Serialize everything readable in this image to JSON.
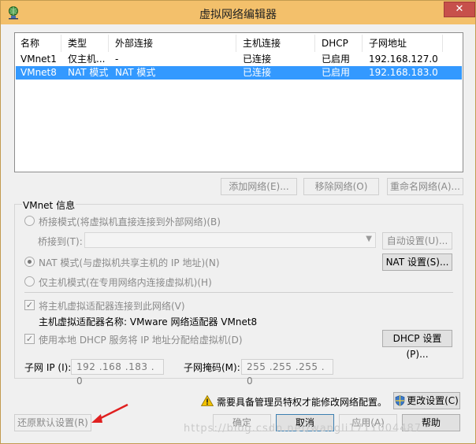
{
  "window": {
    "title": "虚拟网络编辑器",
    "close_glyph": "✕"
  },
  "table": {
    "headers": [
      "名称",
      "类型",
      "外部连接",
      "主机连接",
      "DHCP",
      "子网地址"
    ],
    "rows": [
      {
        "name": "VMnet1",
        "type": "仅主机...",
        "external": "-",
        "host": "已连接",
        "dhcp": "已启用",
        "subnet": "192.168.127.0",
        "selected": false
      },
      {
        "name": "VMnet8",
        "type": "NAT 模式",
        "external": "NAT 模式",
        "host": "已连接",
        "dhcp": "已启用",
        "subnet": "192.168.183.0",
        "selected": true
      }
    ]
  },
  "list_buttons": {
    "add": "添加网络(E)...",
    "remove": "移除网络(O)",
    "rename": "重命名网络(A)..."
  },
  "vmnet_info": {
    "label": "VMnet 信息",
    "bridged_radio": "桥接模式(将虚拟机直接连接到外部网络)(B)",
    "bridged_to_label": "桥接到(T):",
    "auto_settings_button": "自动设置(U)...",
    "nat_radio": "NAT 模式(与虚拟机共享主机的 IP 地址)(N)",
    "nat_settings_button": "NAT 设置(S)...",
    "hostonly_radio": "仅主机模式(在专用网络内连接虚拟机)(H)",
    "connect_adapter_check": "将主机虚拟适配器连接到此网络(V)",
    "adapter_name": "主机虚拟适配器名称: VMware 网络适配器 VMnet8",
    "dhcp_check": "使用本地 DHCP 服务将 IP 地址分配给虚拟机(D)",
    "dhcp_settings_button": "DHCP 设置(P)...",
    "subnet_ip_label": "子网 IP (I):",
    "subnet_ip_value": "192 .168 .183 . 0",
    "subnet_mask_label": "子网掩码(M):",
    "subnet_mask_value": "255 .255 .255 . 0"
  },
  "footer": {
    "admin_warning": "需要具备管理员特权才能修改网络配置。",
    "change_settings_button": "更改设置(C)",
    "restore_defaults_button": "还原默认设置(R)",
    "ok_button": "确定",
    "cancel_button": "取消",
    "apply_button": "应用(A)",
    "help_button": "帮助"
  },
  "watermark": "https://blog.csdn.net/wangli1711004487",
  "colors": {
    "titlebar": "#f3c06b",
    "selection": "#3399ff",
    "close": "#c7504b",
    "annotation_arrow": "#e02020"
  }
}
